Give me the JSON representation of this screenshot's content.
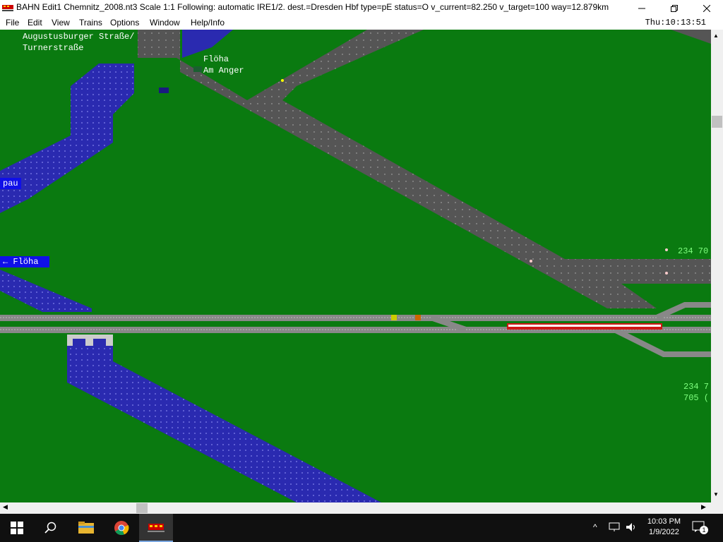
{
  "window": {
    "title": "BAHN Edit1 Chemnitz_2008.nt3 Scale 1:1 Following: automatic IRE1/2.  dest.=Dresden Hbf type=pE status=O  v_current=82.250 v_target=100 way=12.879km",
    "clock": "Thu:10:13:51"
  },
  "menu": [
    "File",
    "Edit",
    "View",
    "Trains",
    "Options",
    "Window",
    "Help/Info"
  ],
  "map": {
    "street_label_1": "Augustusburger Straße/",
    "street_label_2": "Turnerstraße",
    "stop_label_1": "Flöha",
    "stop_label_2": "Am Anger",
    "station_tag_left": "pau",
    "station_tag_floeha": "← Flöha",
    "route_top_right": "234 70",
    "route_bottom_1": "234 7",
    "route_bottom_2": "705 ("
  },
  "taskbar": {
    "time": "10:03 PM",
    "date": "1/9/2022",
    "notification_count": "1"
  },
  "icons": {
    "minimize": "minimize-icon",
    "maximize": "restore-icon",
    "close": "close-icon",
    "start": "windows-start-icon",
    "search": "search-icon",
    "explorer": "folder-icon",
    "chrome": "chrome-icon",
    "bahn": "train-icon"
  }
}
